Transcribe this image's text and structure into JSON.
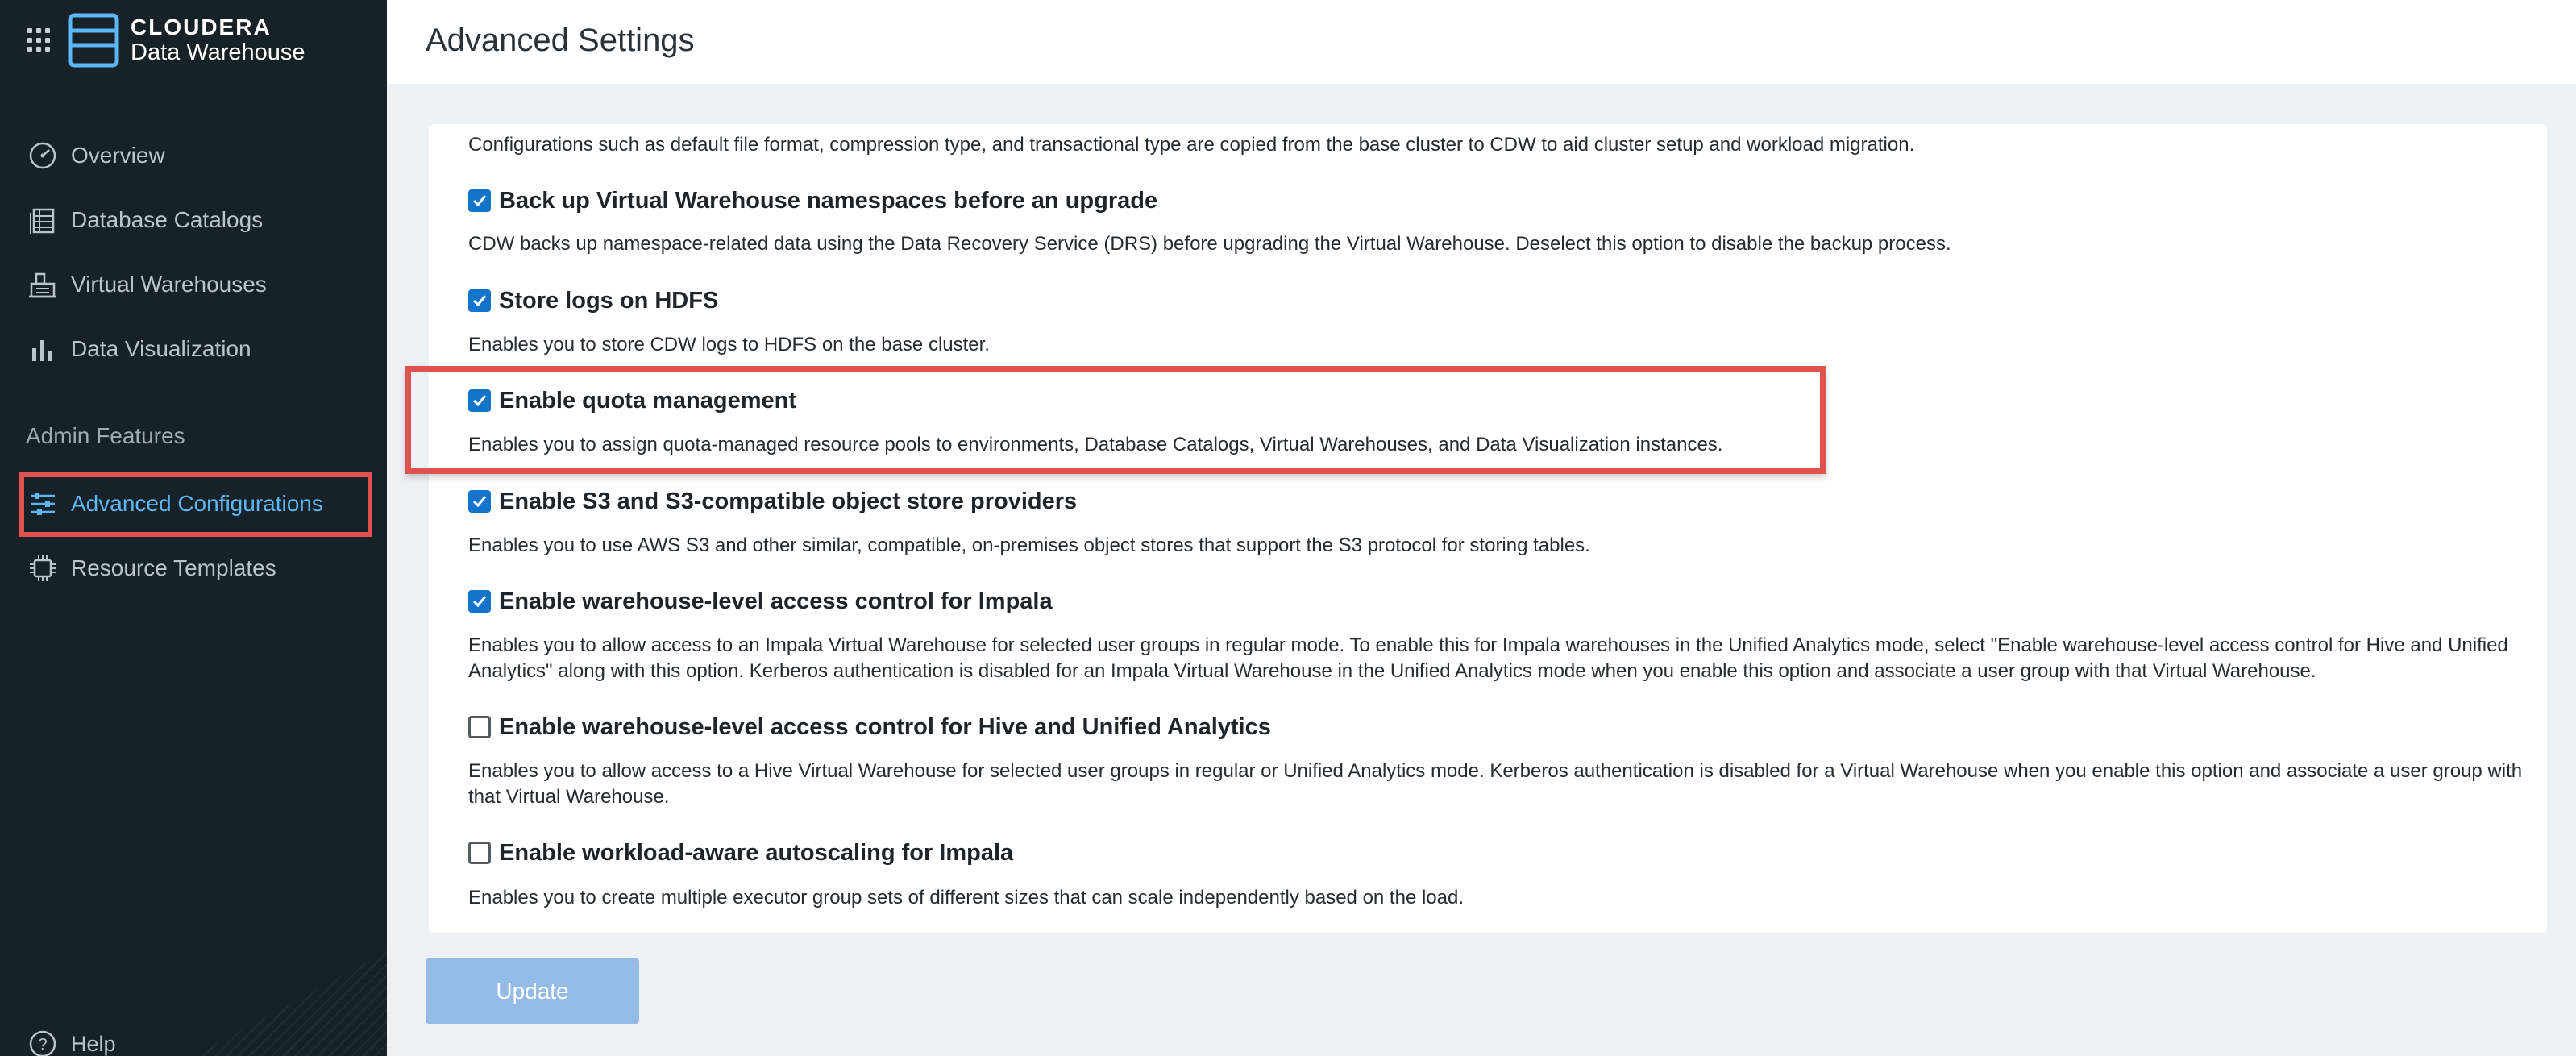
{
  "brand": {
    "company": "CLOUDERA",
    "product": "Data Warehouse"
  },
  "sidebar": {
    "items": [
      {
        "label": "Overview",
        "icon": "gauge-icon"
      },
      {
        "label": "Database Catalogs",
        "icon": "catalog-icon"
      },
      {
        "label": "Virtual Warehouses",
        "icon": "warehouse-icon"
      },
      {
        "label": "Data Visualization",
        "icon": "bar-chart-icon"
      }
    ],
    "section_label": "Admin Features",
    "admin_items": [
      {
        "label": "Advanced Configurations",
        "icon": "sliders-icon",
        "active": true
      },
      {
        "label": "Resource Templates",
        "icon": "chip-icon"
      }
    ],
    "help_label": "Help"
  },
  "page": {
    "title": "Advanced Settings",
    "intro": "Configurations such as default file format, compression type, and transactional type are copied from the base cluster to CDW to aid cluster setup and workload migration.",
    "options": [
      {
        "title": "Back up Virtual Warehouse namespaces before an upgrade",
        "checked": true,
        "description": "CDW backs up namespace-related data using the Data Recovery Service (DRS) before upgrading the Virtual Warehouse. Deselect this option to disable the backup process."
      },
      {
        "title": "Store logs on HDFS",
        "checked": true,
        "description": "Enables you to store CDW logs to HDFS on the base cluster."
      },
      {
        "title": "Enable quota management",
        "checked": true,
        "description": "Enables you to assign quota-managed resource pools to environments, Database Catalogs, Virtual Warehouses, and Data Visualization instances."
      },
      {
        "title": "Enable S3 and S3-compatible object store providers",
        "checked": true,
        "description": "Enables you to use AWS S3 and other similar, compatible, on-premises object stores that support the S3 protocol for storing tables."
      },
      {
        "title": "Enable warehouse-level access control for Impala",
        "checked": true,
        "description": "Enables you to allow access to an Impala Virtual Warehouse for selected user groups in regular mode. To enable this for Impala warehouses in the Unified Analytics mode, select \"Enable warehouse-level access control for Hive and Unified Analytics\" along with this option. Kerberos authentication is disabled for an Impala Virtual Warehouse in the Unified Analytics mode when you enable this option and associate a user group with that Virtual Warehouse."
      },
      {
        "title": "Enable warehouse-level access control for Hive and Unified Analytics",
        "checked": false,
        "description": "Enables you to allow access to a Hive Virtual Warehouse for selected user groups in regular or Unified Analytics mode. Kerberos authentication is disabled for a Virtual Warehouse when you enable this option and associate a user group with that Virtual Warehouse."
      },
      {
        "title": "Enable workload-aware autoscaling for Impala",
        "checked": false,
        "description": "Enables you to create multiple executor group sets of different sizes that can scale independently based on the load."
      }
    ],
    "update_label": "Update"
  },
  "colors": {
    "sidebar_bg": "#172128",
    "accent": "#1474cc",
    "active_nav": "#5bb8f5",
    "highlight": "#e0524d",
    "button_disabled": "#93bbe6"
  }
}
